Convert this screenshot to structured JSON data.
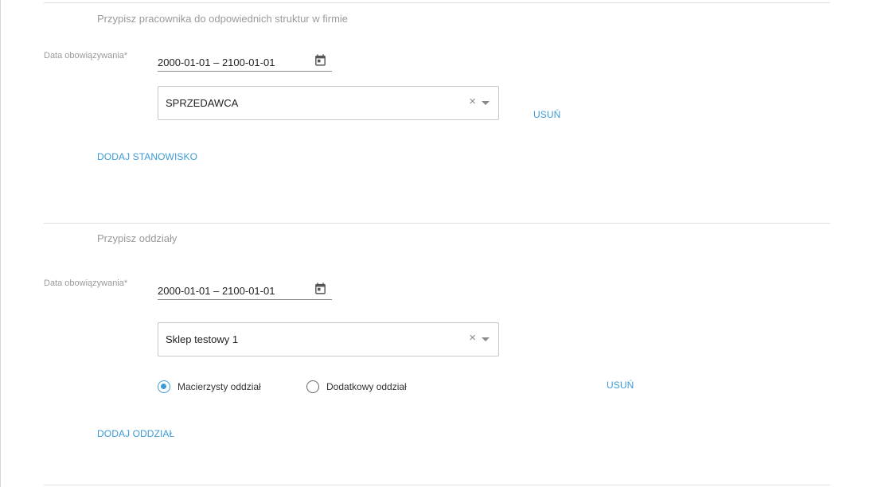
{
  "section_positions": {
    "title": "Przypisz pracownika do odpowiednich struktur w firmie",
    "date_label": "Data obowiązywania*",
    "date_range": "2000-01-01 – 2100-01-01",
    "select_value": "SPRZEDAWCA",
    "remove_label": "USUŃ",
    "add_label": "DODAJ STANOWISKO"
  },
  "section_branches": {
    "title": "Przypisz oddziały",
    "date_label": "Data obowiązywania*",
    "date_range": "2000-01-01 – 2100-01-01",
    "select_value": "Sklep testowy 1",
    "radio_primary_label": "Macierzysty oddział",
    "radio_primary_checked": true,
    "radio_secondary_label": "Dodatkowy oddział",
    "radio_secondary_checked": false,
    "remove_label": "USUŃ",
    "add_label": "DODAJ ODDZIAŁ"
  },
  "icons": {
    "calendar": "calendar-icon",
    "clear": "×",
    "dropdown": "chevron-down-icon"
  },
  "colors": {
    "accent": "#3b9bd6",
    "muted_text": "#9a9a9a",
    "divider": "#e0e0e0"
  }
}
